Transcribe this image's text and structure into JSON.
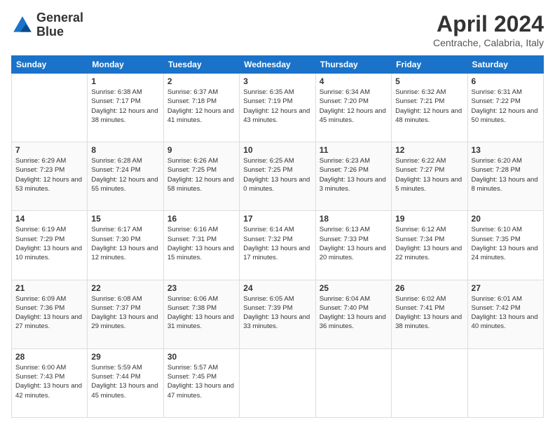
{
  "header": {
    "logo_line1": "General",
    "logo_line2": "Blue",
    "title": "April 2024",
    "location": "Centrache, Calabria, Italy"
  },
  "days_of_week": [
    "Sunday",
    "Monday",
    "Tuesday",
    "Wednesday",
    "Thursday",
    "Friday",
    "Saturday"
  ],
  "weeks": [
    [
      {
        "day": "",
        "sunrise": "",
        "sunset": "",
        "daylight": ""
      },
      {
        "day": "1",
        "sunrise": "Sunrise: 6:38 AM",
        "sunset": "Sunset: 7:17 PM",
        "daylight": "Daylight: 12 hours and 38 minutes."
      },
      {
        "day": "2",
        "sunrise": "Sunrise: 6:37 AM",
        "sunset": "Sunset: 7:18 PM",
        "daylight": "Daylight: 12 hours and 41 minutes."
      },
      {
        "day": "3",
        "sunrise": "Sunrise: 6:35 AM",
        "sunset": "Sunset: 7:19 PM",
        "daylight": "Daylight: 12 hours and 43 minutes."
      },
      {
        "day": "4",
        "sunrise": "Sunrise: 6:34 AM",
        "sunset": "Sunset: 7:20 PM",
        "daylight": "Daylight: 12 hours and 45 minutes."
      },
      {
        "day": "5",
        "sunrise": "Sunrise: 6:32 AM",
        "sunset": "Sunset: 7:21 PM",
        "daylight": "Daylight: 12 hours and 48 minutes."
      },
      {
        "day": "6",
        "sunrise": "Sunrise: 6:31 AM",
        "sunset": "Sunset: 7:22 PM",
        "daylight": "Daylight: 12 hours and 50 minutes."
      }
    ],
    [
      {
        "day": "7",
        "sunrise": "Sunrise: 6:29 AM",
        "sunset": "Sunset: 7:23 PM",
        "daylight": "Daylight: 12 hours and 53 minutes."
      },
      {
        "day": "8",
        "sunrise": "Sunrise: 6:28 AM",
        "sunset": "Sunset: 7:24 PM",
        "daylight": "Daylight: 12 hours and 55 minutes."
      },
      {
        "day": "9",
        "sunrise": "Sunrise: 6:26 AM",
        "sunset": "Sunset: 7:25 PM",
        "daylight": "Daylight: 12 hours and 58 minutes."
      },
      {
        "day": "10",
        "sunrise": "Sunrise: 6:25 AM",
        "sunset": "Sunset: 7:25 PM",
        "daylight": "Daylight: 13 hours and 0 minutes."
      },
      {
        "day": "11",
        "sunrise": "Sunrise: 6:23 AM",
        "sunset": "Sunset: 7:26 PM",
        "daylight": "Daylight: 13 hours and 3 minutes."
      },
      {
        "day": "12",
        "sunrise": "Sunrise: 6:22 AM",
        "sunset": "Sunset: 7:27 PM",
        "daylight": "Daylight: 13 hours and 5 minutes."
      },
      {
        "day": "13",
        "sunrise": "Sunrise: 6:20 AM",
        "sunset": "Sunset: 7:28 PM",
        "daylight": "Daylight: 13 hours and 8 minutes."
      }
    ],
    [
      {
        "day": "14",
        "sunrise": "Sunrise: 6:19 AM",
        "sunset": "Sunset: 7:29 PM",
        "daylight": "Daylight: 13 hours and 10 minutes."
      },
      {
        "day": "15",
        "sunrise": "Sunrise: 6:17 AM",
        "sunset": "Sunset: 7:30 PM",
        "daylight": "Daylight: 13 hours and 12 minutes."
      },
      {
        "day": "16",
        "sunrise": "Sunrise: 6:16 AM",
        "sunset": "Sunset: 7:31 PM",
        "daylight": "Daylight: 13 hours and 15 minutes."
      },
      {
        "day": "17",
        "sunrise": "Sunrise: 6:14 AM",
        "sunset": "Sunset: 7:32 PM",
        "daylight": "Daylight: 13 hours and 17 minutes."
      },
      {
        "day": "18",
        "sunrise": "Sunrise: 6:13 AM",
        "sunset": "Sunset: 7:33 PM",
        "daylight": "Daylight: 13 hours and 20 minutes."
      },
      {
        "day": "19",
        "sunrise": "Sunrise: 6:12 AM",
        "sunset": "Sunset: 7:34 PM",
        "daylight": "Daylight: 13 hours and 22 minutes."
      },
      {
        "day": "20",
        "sunrise": "Sunrise: 6:10 AM",
        "sunset": "Sunset: 7:35 PM",
        "daylight": "Daylight: 13 hours and 24 minutes."
      }
    ],
    [
      {
        "day": "21",
        "sunrise": "Sunrise: 6:09 AM",
        "sunset": "Sunset: 7:36 PM",
        "daylight": "Daylight: 13 hours and 27 minutes."
      },
      {
        "day": "22",
        "sunrise": "Sunrise: 6:08 AM",
        "sunset": "Sunset: 7:37 PM",
        "daylight": "Daylight: 13 hours and 29 minutes."
      },
      {
        "day": "23",
        "sunrise": "Sunrise: 6:06 AM",
        "sunset": "Sunset: 7:38 PM",
        "daylight": "Daylight: 13 hours and 31 minutes."
      },
      {
        "day": "24",
        "sunrise": "Sunrise: 6:05 AM",
        "sunset": "Sunset: 7:39 PM",
        "daylight": "Daylight: 13 hours and 33 minutes."
      },
      {
        "day": "25",
        "sunrise": "Sunrise: 6:04 AM",
        "sunset": "Sunset: 7:40 PM",
        "daylight": "Daylight: 13 hours and 36 minutes."
      },
      {
        "day": "26",
        "sunrise": "Sunrise: 6:02 AM",
        "sunset": "Sunset: 7:41 PM",
        "daylight": "Daylight: 13 hours and 38 minutes."
      },
      {
        "day": "27",
        "sunrise": "Sunrise: 6:01 AM",
        "sunset": "Sunset: 7:42 PM",
        "daylight": "Daylight: 13 hours and 40 minutes."
      }
    ],
    [
      {
        "day": "28",
        "sunrise": "Sunrise: 6:00 AM",
        "sunset": "Sunset: 7:43 PM",
        "daylight": "Daylight: 13 hours and 42 minutes."
      },
      {
        "day": "29",
        "sunrise": "Sunrise: 5:59 AM",
        "sunset": "Sunset: 7:44 PM",
        "daylight": "Daylight: 13 hours and 45 minutes."
      },
      {
        "day": "30",
        "sunrise": "Sunrise: 5:57 AM",
        "sunset": "Sunset: 7:45 PM",
        "daylight": "Daylight: 13 hours and 47 minutes."
      },
      {
        "day": "",
        "sunrise": "",
        "sunset": "",
        "daylight": ""
      },
      {
        "day": "",
        "sunrise": "",
        "sunset": "",
        "daylight": ""
      },
      {
        "day": "",
        "sunrise": "",
        "sunset": "",
        "daylight": ""
      },
      {
        "day": "",
        "sunrise": "",
        "sunset": "",
        "daylight": ""
      }
    ]
  ]
}
